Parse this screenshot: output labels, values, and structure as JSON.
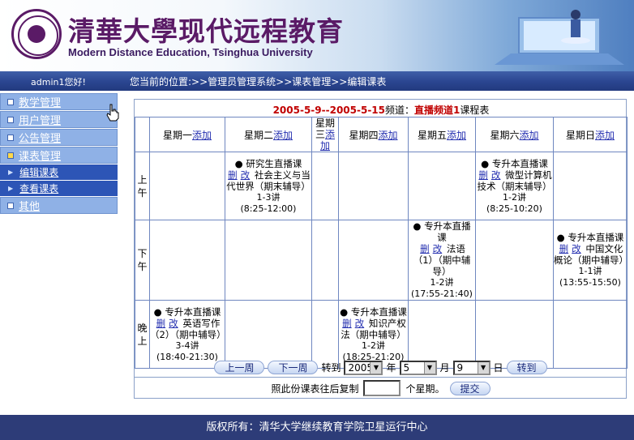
{
  "header": {
    "title_cn": "清華大學现代远程教育",
    "title_en": "Modern Distance Education, Tsinghua University"
  },
  "navbar": {
    "greeting": "admin1您好!",
    "breadcrumb": "您当前的位置:>>管理员管理系统>>课表管理>>编辑课表"
  },
  "sidebar": {
    "items": [
      {
        "label": "教学管理",
        "icon": "square-bullet-icon"
      },
      {
        "label": "用户管理",
        "icon": "square-bullet-icon"
      },
      {
        "label": "公告管理",
        "icon": "square-bullet-icon"
      },
      {
        "label": "课表管理",
        "icon": "square-bullet-icon"
      }
    ],
    "subitems": [
      {
        "label": "编辑课表",
        "icon": "arrow-icon"
      },
      {
        "label": "查看课表",
        "icon": "arrow-icon"
      }
    ],
    "other": {
      "label": "其他"
    }
  },
  "schedule": {
    "date_range": "2005-5-9--2005-5-15",
    "channel_prefix": "频道：",
    "channel_name": "直播频道1",
    "suffix": "课程表",
    "add_label": "添加",
    "days": [
      "星期一",
      "星期二",
      "星期三",
      "星期四",
      "星期五",
      "星期六",
      "星期日"
    ],
    "periods": [
      "上午",
      "下午",
      "晚上"
    ],
    "courses": {
      "morning_tue": {
        "type": "研究生直播课",
        "del": "删",
        "edit": "改",
        "name": "社会主义与当代世界（期末辅导）",
        "lectures": "1-3讲",
        "time": "(8:25-12:00)"
      },
      "morning_sat": {
        "type": "专升本直播课",
        "del": "删",
        "edit": "改",
        "name": "微型计算机技术（期末辅导）",
        "lectures": "1-2讲",
        "time": "(8:25-10:20)"
      },
      "afternoon_fri": {
        "type": "专升本直播课",
        "del": "删",
        "edit": "改",
        "name": "法语（1）（期中辅导）",
        "lectures": "1-2讲",
        "time": "(17:55-21:40)"
      },
      "afternoon_sun": {
        "type": "专升本直播课",
        "del": "删",
        "edit": "改",
        "name": "中国文化概论（期中辅导）",
        "lectures": "1-1讲",
        "time": "(13:55-15:50)"
      },
      "evening_mon": {
        "type": "专升本直播课",
        "del": "删",
        "edit": "改",
        "name": "英语写作（2）（期中辅导）",
        "lectures": "3-4讲",
        "time": "(18:40-21:30)"
      },
      "evening_thu": {
        "type": "专升本直播课",
        "del": "删",
        "edit": "改",
        "name": "知识产权法（期中辅导）",
        "lectures": "1-2讲",
        "time": "(18:25-21:20)"
      }
    }
  },
  "controls": {
    "prev_week": "上一周",
    "next_week": "下一周",
    "goto_label": "转到",
    "year_value": "2005",
    "year_unit": "年",
    "month_value": "5",
    "month_unit": "月",
    "day_value": "9",
    "day_unit": "日",
    "goto_button": "转到",
    "copy_prefix": "照此份课表往后复制",
    "copy_suffix": "个星期。",
    "submit_button": "提交"
  },
  "footer": {
    "text": "版权所有：清华大学继续教育学院卫星运行中心"
  }
}
